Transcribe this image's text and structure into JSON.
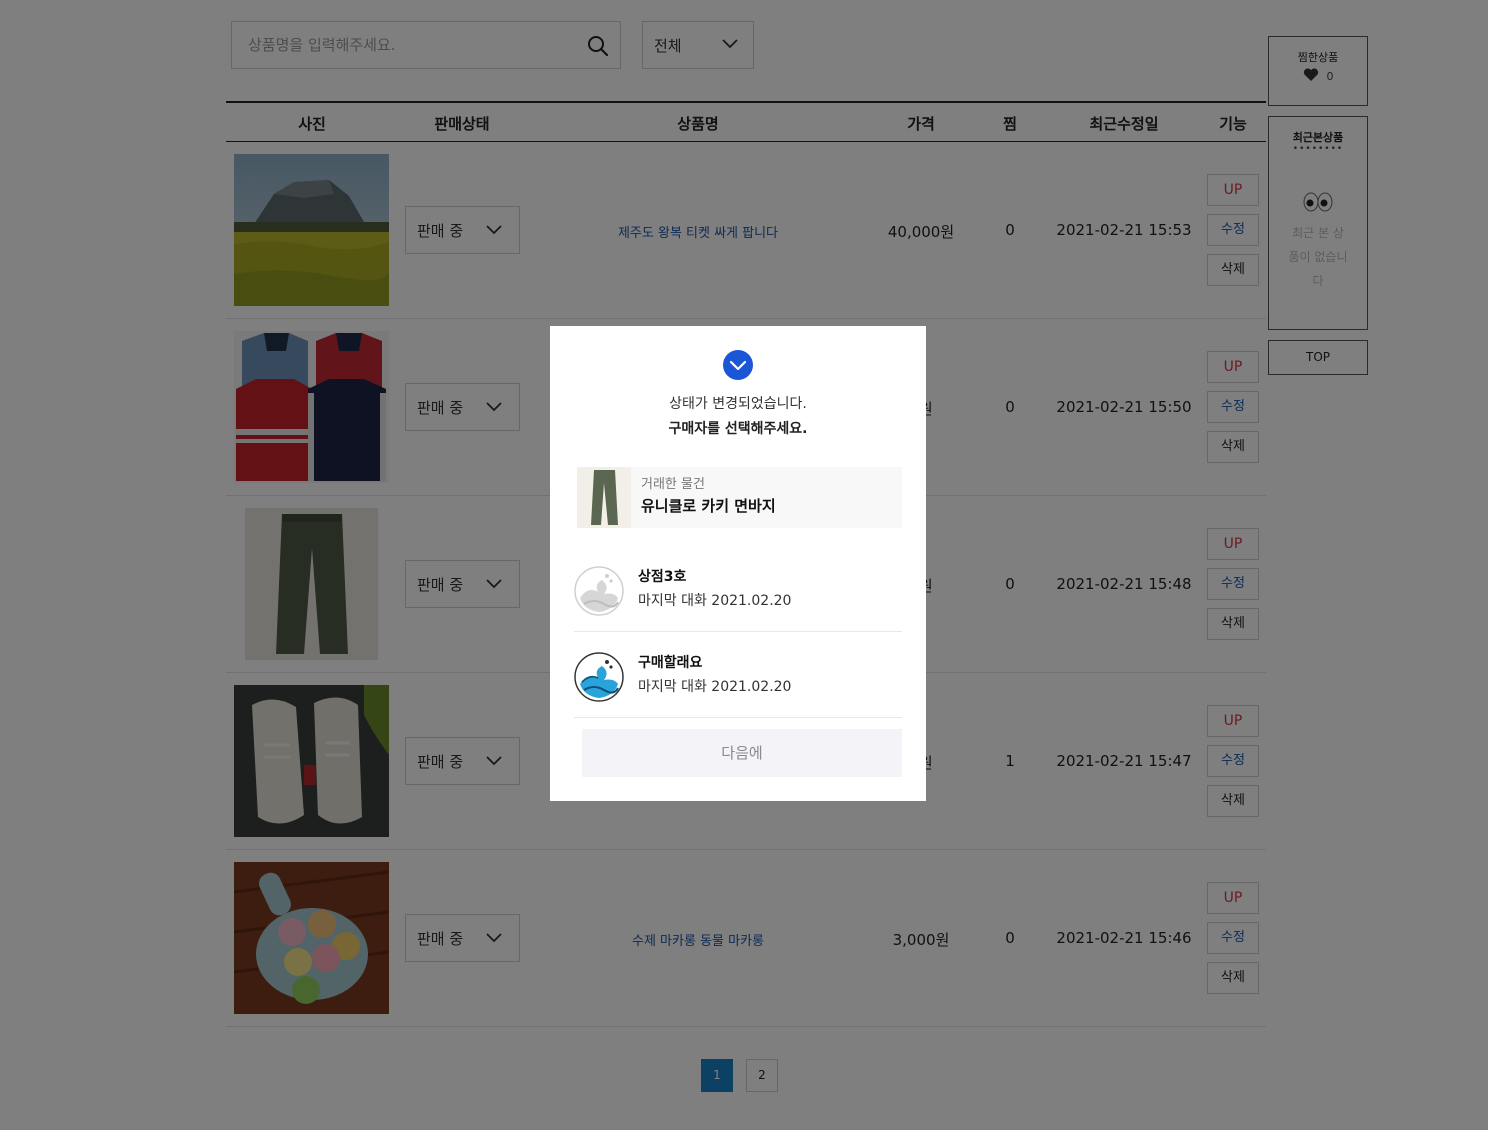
{
  "search": {
    "placeholder": "상품명을 입력해주세요.",
    "icon": "search-icon"
  },
  "filter": {
    "selected": "전체"
  },
  "table": {
    "headers": [
      "사진",
      "판매상태",
      "상품명",
      "가격",
      "찜",
      "최근수정일",
      "기능"
    ],
    "rows": [
      {
        "status": "판매 중",
        "title": "제주도 왕복 티켓 싸게 팝니다",
        "price": "40,000원",
        "likes": "0",
        "date": "2021-02-21 15:53"
      },
      {
        "status": "판매 중",
        "title": "",
        "price": "0원",
        "likes": "0",
        "date": "2021-02-21 15:50"
      },
      {
        "status": "판매 중",
        "title": "",
        "price": "0원",
        "likes": "0",
        "date": "2021-02-21 15:48"
      },
      {
        "status": "판매 중",
        "title": "",
        "price": "0원",
        "likes": "1",
        "date": "2021-02-21 15:47"
      },
      {
        "status": "판매 중",
        "title": "수제 마카롱 동물 마카롱",
        "price": "3,000원",
        "likes": "0",
        "date": "2021-02-21 15:46"
      }
    ],
    "actions": {
      "up": "UP",
      "edit": "수정",
      "delete": "삭제"
    }
  },
  "pagination": {
    "pages": [
      "1",
      "2"
    ],
    "current": "1"
  },
  "sidebar": {
    "liked": {
      "title": "찜한상품",
      "count": "0"
    },
    "recent": {
      "title": "최근본상품",
      "dots": "••••••••",
      "empty": "최근 본 상품이 없습니다"
    },
    "top": "TOP"
  },
  "modal": {
    "message_line1": "상태가 변경되었습니다.",
    "message_line2": "구매자를 선택해주세요.",
    "item_caption": "거래한 물건",
    "item_name": "유니클로 카키 면바지",
    "buyers": [
      {
        "name": "상점3호",
        "last_chat": "마지막 대화 2021.02.20"
      },
      {
        "name": "구매할래요",
        "last_chat": "마지막 대화 2021.02.20"
      }
    ],
    "later_button": "다음에"
  },
  "colors": {
    "accent_blue": "#1a56d6",
    "up_red": "#d9363e",
    "link_blue": "#1a56a8",
    "page_active": "#1a83c6"
  }
}
